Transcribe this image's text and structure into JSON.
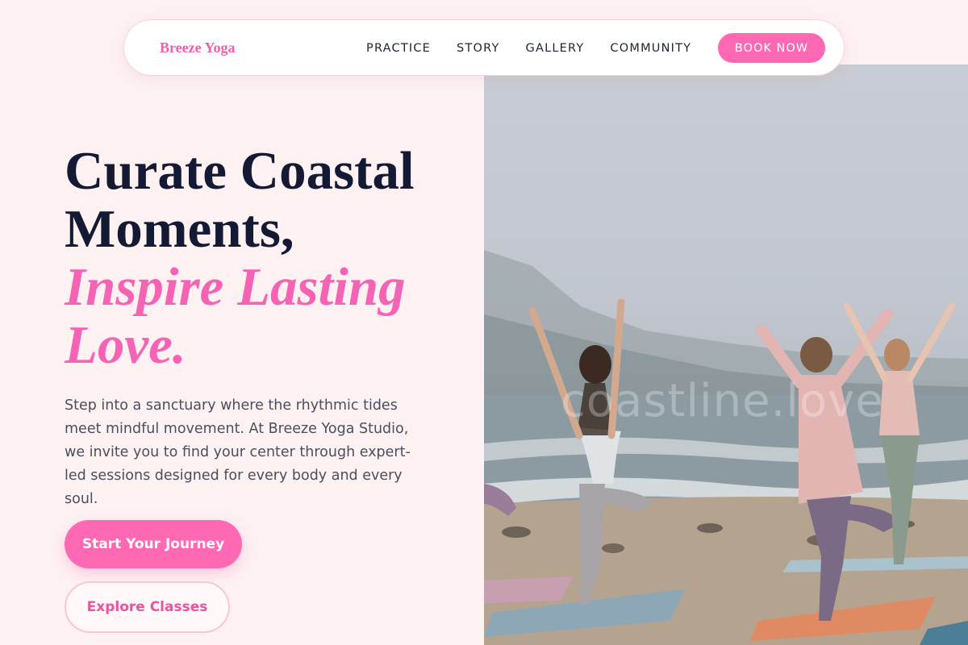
{
  "nav": {
    "brand": "Breeze Yoga",
    "links": [
      "PRACTICE",
      "STORY",
      "GALLERY",
      "COMMUNITY"
    ],
    "cta": "BOOK NOW"
  },
  "hero": {
    "headline_line1": "Curate Coastal",
    "headline_line2": "Moments,",
    "headline_accent_line1": "Inspire Lasting",
    "headline_accent_line2": "Love.",
    "description": "Step into a sanctuary where the rhythmic tides meet mindful movement. At Breeze Yoga Studio, we invite you to find your center through expert-led sessions designed for every body and every soul.",
    "primary_button": "Start Your Journey",
    "secondary_button": "Explore Classes",
    "image_watermark": "coastline.love"
  },
  "colors": {
    "background": "#fdf1f2",
    "accent": "#ff69b4",
    "headline": "#141a33"
  }
}
